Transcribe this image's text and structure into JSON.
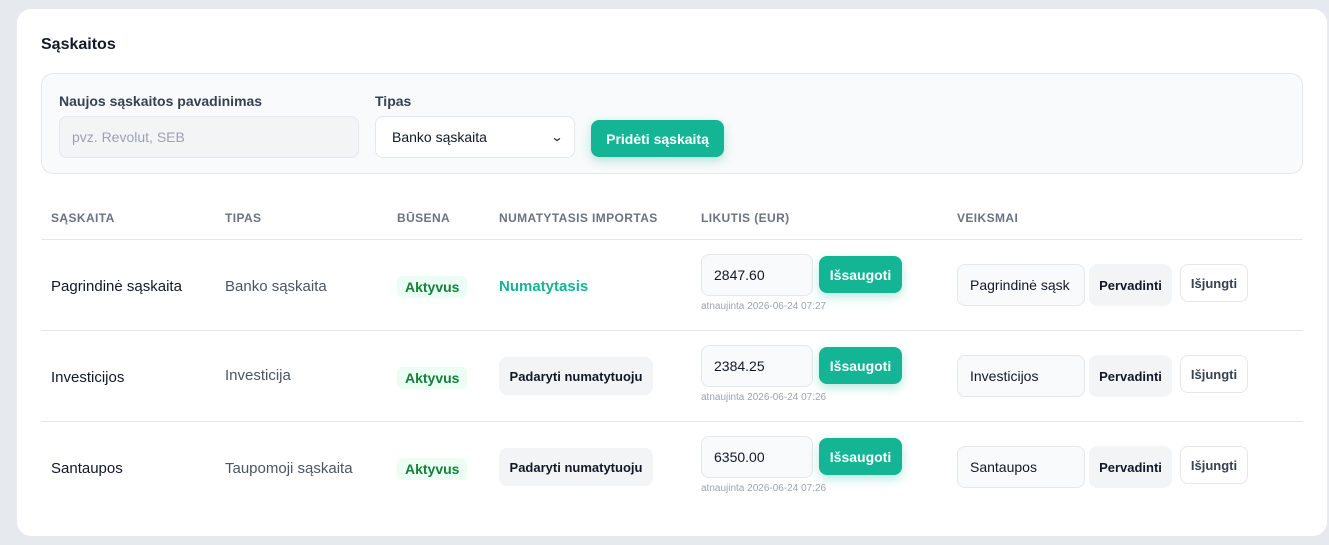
{
  "page": {
    "title": "Sąskaitos"
  },
  "form": {
    "name_label": "Naujos sąskaitos pavadinimas",
    "name_placeholder": "pvz. Revolut, SEB",
    "name_value": "",
    "type_label": "Tipas",
    "type_selected": "Banko sąskaita",
    "add_button": "Pridėti sąskaitą"
  },
  "table": {
    "headers": {
      "account": "SĄSKAITA",
      "type": "TIPAS",
      "status": "BŪSENA",
      "default_import": "NUMATYTASIS IMPORTAS",
      "balance": "LIKUTIS (EUR)",
      "actions": "VEIKSMAI"
    },
    "rows": [
      {
        "name": "Pagrindinė sąskaita",
        "type": "Banko sąskaita",
        "status": "Aktyvus",
        "default_text": "Numatytasis",
        "is_default": true,
        "balance": "2847.60",
        "save": "Išsaugoti",
        "updated": "atnaujinta 2026-06-24 07:27",
        "rename_value": "Pagrindinė sąsk",
        "rename": "Pervadinti",
        "disable": "Išjungti"
      },
      {
        "name": "Investicijos",
        "type": "Investicija",
        "status": "Aktyvus",
        "make_default": "Padaryti numatytuoju",
        "is_default": false,
        "balance": "2384.25",
        "save": "Išsaugoti",
        "updated": "atnaujinta 2026-06-24 07:26",
        "rename_value": "Investicijos",
        "rename": "Pervadinti",
        "disable": "Išjungti"
      },
      {
        "name": "Santaupos",
        "type": "Taupomoji sąskaita",
        "status": "Aktyvus",
        "make_default": "Padaryti numatytuoju",
        "is_default": false,
        "balance": "6350.00",
        "save": "Išsaugoti",
        "updated": "atnaujinta 2026-06-24 07:26",
        "rename_value": "Santaupos",
        "rename": "Pervadinti",
        "disable": "Išjungti"
      }
    ]
  },
  "colors": {
    "accent": "#13b594",
    "status_green": "#15803d",
    "page_bg": "#e6e9ee"
  },
  "icons": {
    "select_chevron": "chevron-down-icon"
  }
}
